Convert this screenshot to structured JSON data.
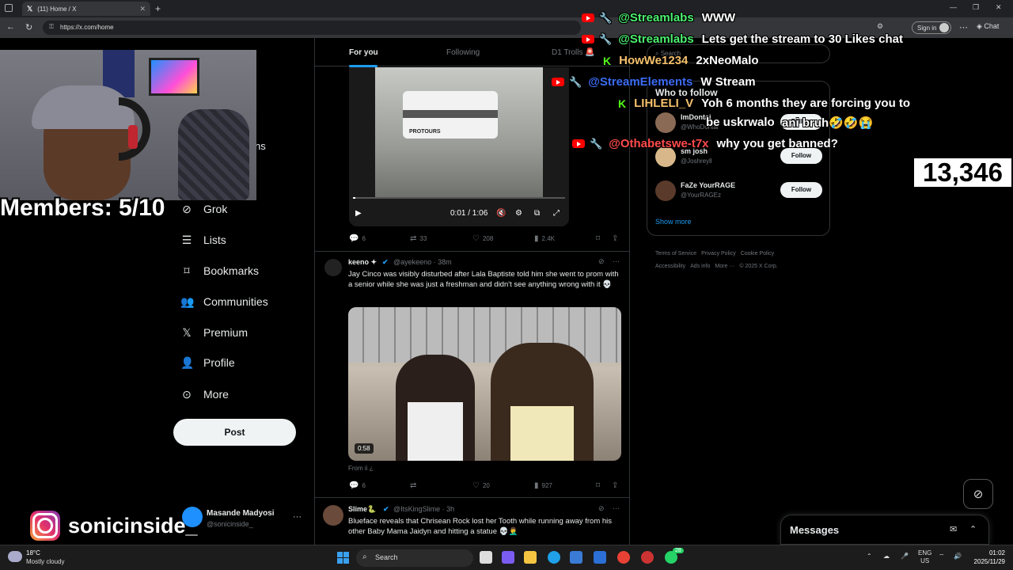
{
  "browser": {
    "tab_title": "(11) Home / X",
    "url": "https://x.com/home",
    "signin_label": "Sign in",
    "chat_label": "Chat"
  },
  "sidebar": {
    "items": [
      {
        "label": "Grok",
        "icon": "grok-icon"
      },
      {
        "label": "Lists",
        "icon": "lists-icon"
      },
      {
        "label": "Bookmarks",
        "icon": "bookmark-icon"
      },
      {
        "label": "Communities",
        "icon": "communities-icon"
      },
      {
        "label": "Premium",
        "icon": "x-logo-icon"
      },
      {
        "label": "Profile",
        "icon": "profile-icon"
      },
      {
        "label": "More",
        "icon": "more-circle-icon"
      }
    ],
    "partial_label": "ns",
    "post_label": "Post",
    "user": {
      "name": "Masande Madyosi",
      "handle": "@sonicinside_"
    }
  },
  "feed": {
    "tabs": [
      {
        "label": "For you",
        "active": true
      },
      {
        "label": "Following",
        "active": false
      },
      {
        "label": "D1 Trolls 🚨",
        "active": false
      }
    ],
    "video1": {
      "time": "0:01 / 1:06",
      "bus_text": "PROTOURS",
      "progress": 0.01
    },
    "tweet0_actions": {
      "replies": "6",
      "retweets": "33",
      "likes": "208",
      "views": "2.4K"
    },
    "tweet1": {
      "name": "keeno ✦",
      "handle": "@ayekeeno · 38m",
      "text": "Jay Cinco was visibly disturbed after Lala Baptiste told him she went to prom with a senior while she was just a freshman and didn't see anything wrong with it 💀",
      "video_time": "0:58",
      "from": "From ii ¿",
      "replies": "6",
      "retweets": "",
      "likes": "20",
      "views": "927"
    },
    "tweet2": {
      "name": "Slime🐍",
      "handle": "@ItsKingSlime · 3h",
      "text": "Blueface reveals that Chrisean Rock lost her Tooth while running away from his other Baby Mama Jaidyn and hitting a statue 💀🤦‍♂️"
    }
  },
  "right": {
    "search_placeholder": "Search",
    "who_to_follow": "Who to follow",
    "follow_label": "Follow",
    "suggestions": [
      {
        "name": "ImDontai",
        "handle": "@WhoDontai"
      },
      {
        "name": "sm josh",
        "handle": "@Joshreyll"
      },
      {
        "name": "FaZe YourRAGE",
        "handle": "@YourRAGEz"
      }
    ],
    "show_more": "Show more",
    "footer": [
      "Terms of Service",
      "Privacy Policy",
      "Cookie Policy",
      "Accessibility",
      "Ads info",
      "More ···",
      "© 2025 X Corp."
    ]
  },
  "messages": {
    "title": "Messages"
  },
  "overlay": {
    "members": "Members: 5/10",
    "counter": "13,346",
    "instagram": "sonicinside_",
    "chat": [
      {
        "platform": "youtube",
        "user": "@Streamlabs",
        "msg": "WWW",
        "color": "#4cf06f"
      },
      {
        "platform": "youtube",
        "user": "@Streamlabs",
        "msg": "Lets get the stream to 30 Likes chat",
        "color": "#4cf06f"
      },
      {
        "platform": "kick",
        "user": "HowWe1234",
        "msg": "2xNeoMalo",
        "color": "#f5c16c"
      },
      {
        "platform": "youtube",
        "user": "@StreamElements",
        "msg": "W Stream",
        "color": "#3b6cf5"
      },
      {
        "platform": "kick",
        "user": "LIHLELI_V",
        "msg": "Yoh 6 months they are forcing you to",
        "color": "#f5c16c"
      },
      {
        "platform": "none",
        "user": "",
        "msg": "be uskrwalo",
        "color": "#ffffff"
      },
      {
        "platform": "none",
        "user": "",
        "msg": "ani bruh🤣🤣😭",
        "color": "#ffffff"
      },
      {
        "platform": "youtube",
        "user": "@Othabetswe-t7x",
        "msg": "why you get banned?",
        "color": "#ff4a4a"
      }
    ]
  },
  "taskbar": {
    "temp": "18°C",
    "weather": "Mostly cloudy",
    "search": "Search",
    "lang1": "ENG",
    "lang2": "US",
    "time": "01:02",
    "date": "2025/11/29",
    "badge": "28"
  }
}
